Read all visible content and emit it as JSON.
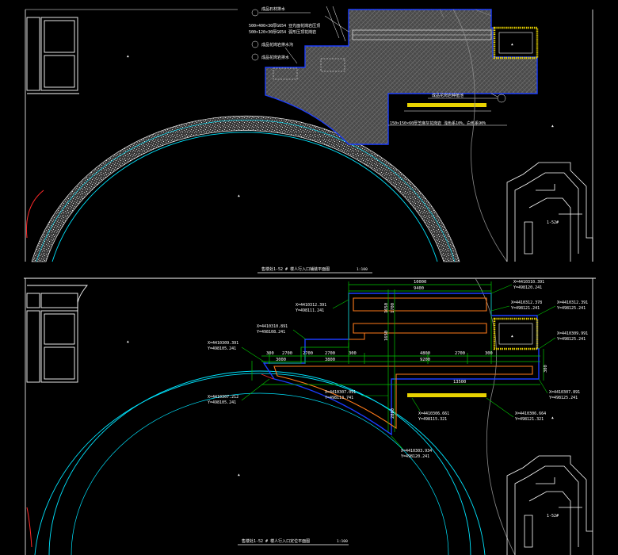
{
  "colors": {
    "background": "#000000",
    "outline": "#ffffff",
    "cyan": "#00e5ff",
    "blue": "#1a3cff",
    "green": "#00c800",
    "yellow": "#e8d200",
    "orange": "#ff7a1a",
    "red": "#ff2a2a",
    "gray": "#8a8a8a"
  },
  "top_plan": {
    "callouts": [
      "成品石材排水",
      "500×400×30厚G654 亚光面花岗岩压顶",
      "500×120×30厚G654 弧形压顶花岗岩",
      "成品花岗岩排水沟",
      "成品花岗岩排水"
    ],
    "right_callout": "成品花岗岩种植池",
    "bottom_note": "150×150×60厚芝麻灰花岗岩 浅色系10%，白色系90%",
    "title": "售楼处1-52 # 楼人行入口铺装平面图",
    "title_scale": "1:100",
    "building_label": "1-52#"
  },
  "bottom_plan": {
    "dims_top": [
      "10000",
      "9400"
    ],
    "dims_row": [
      "300",
      "2700",
      "2700",
      "2700",
      "300",
      "4800",
      "2700",
      "300"
    ],
    "dims_row2": [
      "3000",
      "3800",
      "9200"
    ],
    "dims_bottom": "13500",
    "dims_vertical": [
      "1650",
      "1700",
      "1650",
      "2800",
      "300"
    ],
    "coordinates": [
      {
        "x": "X=4410310.391",
        "y": "Y=498120.241"
      },
      {
        "x": "X=4410312.391",
        "y": "Y=498111.241"
      },
      {
        "x": "X=4410310.891",
        "y": "Y=498108.241"
      },
      {
        "x": "X=4410309.391",
        "y": "Y=498105.241"
      },
      {
        "x": "X=4410307.212",
        "y": "Y=498105.241"
      },
      {
        "x": "X=4410307.091",
        "y": "Y=498113.741"
      },
      {
        "x": "X=4410303.934",
        "y": "Y=498120.241"
      },
      {
        "x": "X=4410306.661",
        "y": "Y=498115.321"
      },
      {
        "x": "X=4410312.378",
        "y": "Y=498121.241"
      },
      {
        "x": "X=4410312.391",
        "y": "Y=498125.241"
      },
      {
        "x": "X=4410309.991",
        "y": "Y=498125.241"
      },
      {
        "x": "X=4410306.664",
        "y": "Y=498121.321"
      },
      {
        "x": "X=4410307.891",
        "y": "Y=498125.241"
      }
    ],
    "title": "售楼处1-52 # 楼人行入口定位平面图",
    "title_scale": "1:100",
    "building_label": "1-52#"
  }
}
